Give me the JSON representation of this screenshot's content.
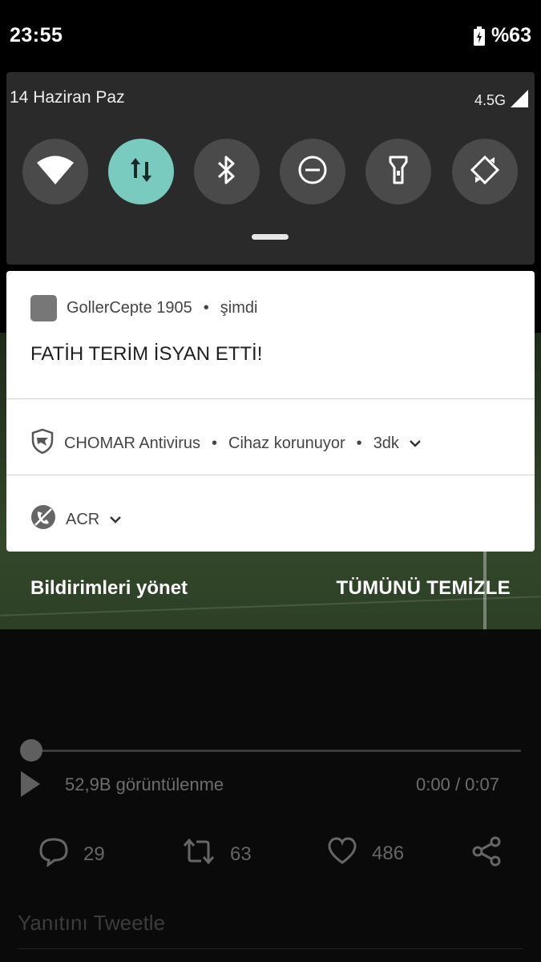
{
  "status_bar": {
    "time": "23:55",
    "battery": "%63"
  },
  "quick_settings": {
    "date": "14 Haziran Paz",
    "network": "4.5G",
    "tiles": [
      {
        "name": "wifi",
        "active": false
      },
      {
        "name": "mobile-data",
        "active": true
      },
      {
        "name": "bluetooth",
        "active": false
      },
      {
        "name": "do-not-disturb",
        "active": false
      },
      {
        "name": "flashlight",
        "active": false
      },
      {
        "name": "auto-rotate",
        "active": false
      }
    ],
    "accent_color": "#79cbc0"
  },
  "notifications": [
    {
      "app": "GollerCepte 1905",
      "time": "şimdi",
      "title": "FATİH TERİM İSYAN ETTİ!"
    },
    {
      "app": "CHOMAR Antivirus",
      "subtitle": "Cihaz korunuyor",
      "time": "3dk"
    },
    {
      "app": "ACR"
    }
  ],
  "footer": {
    "manage": "Bildirimleri yönet",
    "clear_all": "TÜMÜNÜ TEMİZLE"
  },
  "video": {
    "views": "52,9B görüntülenme",
    "time": "0:00 / 0:07"
  },
  "tweet_actions": {
    "replies": "29",
    "retweets": "63",
    "likes": "486"
  },
  "reply_placeholder": "Yanıtını Tweetle"
}
